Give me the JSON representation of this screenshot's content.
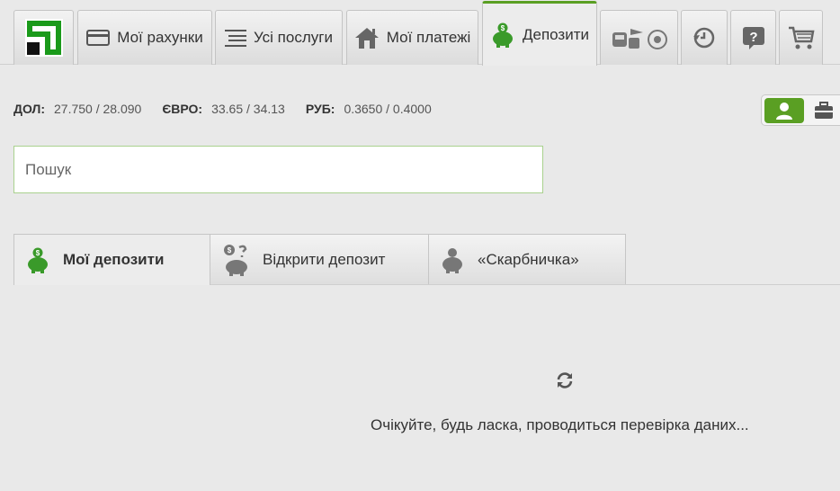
{
  "nav": {
    "tabs": [
      {
        "label": "Мої рахунки",
        "icon": "card-icon"
      },
      {
        "label": "Усі послуги",
        "icon": "list-icon"
      },
      {
        "label": "Мої платежі",
        "icon": "house-icon"
      },
      {
        "label": "Депозити",
        "icon": "piggy-dollar-icon",
        "active": true
      },
      {
        "label": "",
        "icon": "travel-sport-icon"
      },
      {
        "label": "",
        "icon": "history-icon"
      },
      {
        "label": "",
        "icon": "help-icon"
      },
      {
        "label": "",
        "icon": "cart-icon"
      }
    ]
  },
  "rates": {
    "usd_label": "ДОЛ:",
    "usd_value": "27.750 / 28.090",
    "eur_label": "ЄВРО:",
    "eur_value": "33.65 / 34.13",
    "rub_label": "РУБ:",
    "rub_value": "0.3650 / 0.4000"
  },
  "account_toggle": {
    "options": [
      "person-icon",
      "briefcase-icon"
    ],
    "selected": "person-icon"
  },
  "search": {
    "placeholder": "Пошук",
    "value": ""
  },
  "subtabs": [
    {
      "label": "Мої депозити",
      "icon": "piggy-dollar-icon",
      "active": true
    },
    {
      "label": "Відкрити депозит",
      "icon": "piggy-coins-icon"
    },
    {
      "label": "«Скарбничка»",
      "icon": "piggy-icon"
    }
  ],
  "loading": {
    "text": "Очікуйте, будь ласка, проводиться перевірка даних..."
  },
  "colors": {
    "accent": "#5a9f23",
    "logo": "#1a9a1a"
  }
}
